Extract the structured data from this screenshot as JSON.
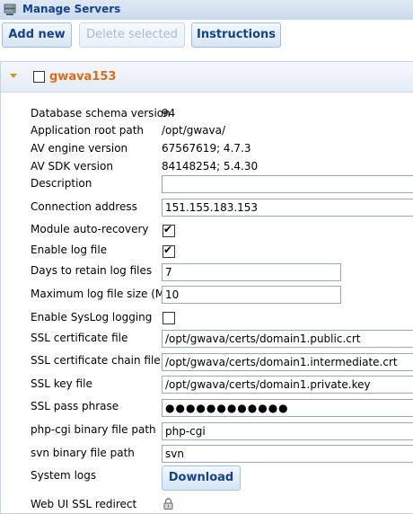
{
  "window": {
    "title": "Manage Servers",
    "icon": "server-icon"
  },
  "toolbar": {
    "add_label": "Add new",
    "delete_label": "Delete selected",
    "instructions_label": "Instructions"
  },
  "server": {
    "name": "gwava153",
    "selected": false,
    "expanded": true
  },
  "fields": {
    "db_schema": {
      "label": "Database schema version",
      "value": "94"
    },
    "app_root": {
      "label": "Application root path",
      "value": "/opt/gwava/"
    },
    "av_engine": {
      "label": "AV engine version",
      "value": "67567619; 4.7.3"
    },
    "av_sdk": {
      "label": "AV SDK version",
      "value": "84148254; 5.4.30"
    },
    "description": {
      "label": "Description",
      "value": ""
    },
    "connection": {
      "label": "Connection address",
      "value": "151.155.183.153"
    },
    "auto_recovery": {
      "label": "Module auto-recovery",
      "checked": true
    },
    "log_file": {
      "label": "Enable log file",
      "checked": true
    },
    "days_retain": {
      "label": "Days to retain log files",
      "value": "7"
    },
    "max_log": {
      "label": "Maximum log file size (Mb)",
      "value": "10"
    },
    "syslog": {
      "label": "Enable SysLog logging",
      "checked": false
    },
    "ssl_cert": {
      "label": "SSL certificate file",
      "value": "/opt/gwava/certs/domain1.public.crt"
    },
    "ssl_chain": {
      "label": "SSL certificate chain file",
      "value": "/opt/gwava/certs/domain1.intermediate.crt"
    },
    "ssl_key": {
      "label": "SSL key file",
      "value": "/opt/gwava/certs/domain1.private.key"
    },
    "ssl_pass": {
      "label": "SSL pass phrase",
      "value": "●●●●●●●●●●●●"
    },
    "php_cgi": {
      "label": "php-cgi binary file path",
      "value": "php-cgi"
    },
    "svn": {
      "label": "svn binary file path",
      "value": "svn"
    },
    "system_logs": {
      "label": "System logs",
      "button": "Download"
    },
    "ssl_redirect": {
      "label": "Web UI SSL redirect",
      "icon": "lock-icon"
    }
  },
  "colors": {
    "accent": "#15428b",
    "server_name": "#dd6b18"
  }
}
